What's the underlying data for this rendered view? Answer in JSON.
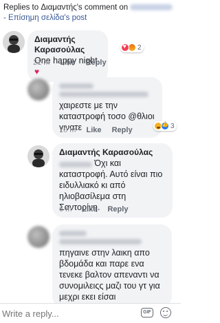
{
  "header": {
    "prefix": "Replies to Διαμαντής's comment on",
    "official_page": "Επίσημη σελίδα",
    "post_suffix": "'s post"
  },
  "comments": [
    {
      "author": "Διαμαντής Καρασούλας",
      "text": "One happy night",
      "time": "21 m",
      "like": "Like",
      "reply": "Reply",
      "reaction_count": "2"
    },
    {
      "text": "χαιρεστε με την καταστροφή τοσο @θλιοι γινατε",
      "time": "10 m",
      "like": "Like",
      "reply": "Reply",
      "reaction_count": "3"
    },
    {
      "author": "Διαμαντής Καρασούλας",
      "text": "Όχι και καταστροφή. Αυτό είναι πιο ειδυλλιακό κι από ηλιοβασίλεμα στη Σαντορίνη.",
      "time": "6 m",
      "like": "Like",
      "reply": "Reply"
    },
    {
      "text": "πηγαινε στην λαικη απο βδομάδα και παρε ενα τενεκε βαλτον απεναντι να συνομιλειςς μαζι του γτ για μεχρι εκει είσαι"
    }
  ],
  "composer": {
    "placeholder": "Write a reply...",
    "gif_label": "GIF"
  },
  "icons": {
    "heart": "heart-icon",
    "gif": "gif-icon",
    "sticker": "sticker-icon"
  },
  "colors": {
    "link": "#385898",
    "bubble": "#f2f3f5",
    "meta": "#90949c"
  }
}
